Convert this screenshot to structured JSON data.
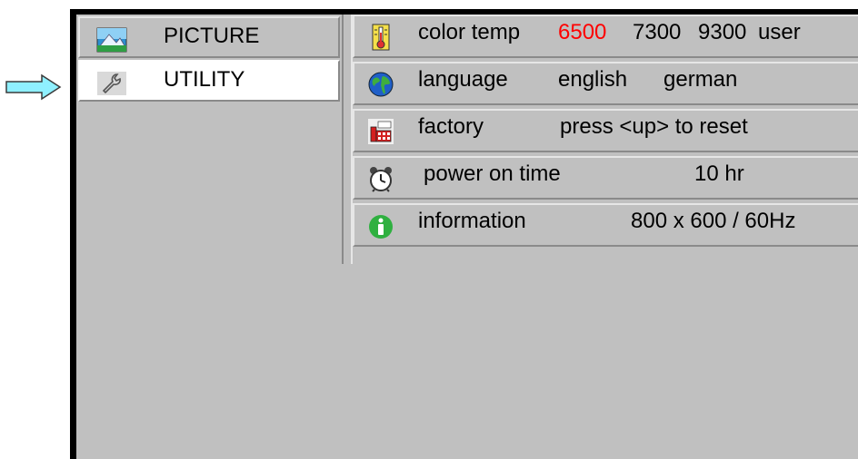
{
  "pointer": {
    "icon": "right-arrow-icon",
    "color": "#8ff0ff"
  },
  "menu": {
    "items": [
      {
        "label": "PICTURE",
        "icon": "landscape-icon",
        "selected": false
      },
      {
        "label": "UTILITY",
        "icon": "wrench-icon",
        "selected": true
      }
    ]
  },
  "settings": {
    "color_temp": {
      "label": "color temp",
      "icon": "thermometer-icon",
      "options": [
        "6500",
        "7300",
        "9300",
        "user"
      ],
      "active_option": "6500",
      "active_color": "#ff0000"
    },
    "language": {
      "label": "language",
      "icon": "globe-icon",
      "options": [
        "english",
        "german"
      ]
    },
    "factory": {
      "label": "factory",
      "icon": "factory-icon",
      "value": "press <up> to reset"
    },
    "power_on_time": {
      "label": "power on time",
      "icon": "alarm-clock-icon",
      "value": "10 hr"
    },
    "information": {
      "label": "information",
      "icon": "info-icon",
      "value": "800 x 600 / 60Hz"
    }
  }
}
